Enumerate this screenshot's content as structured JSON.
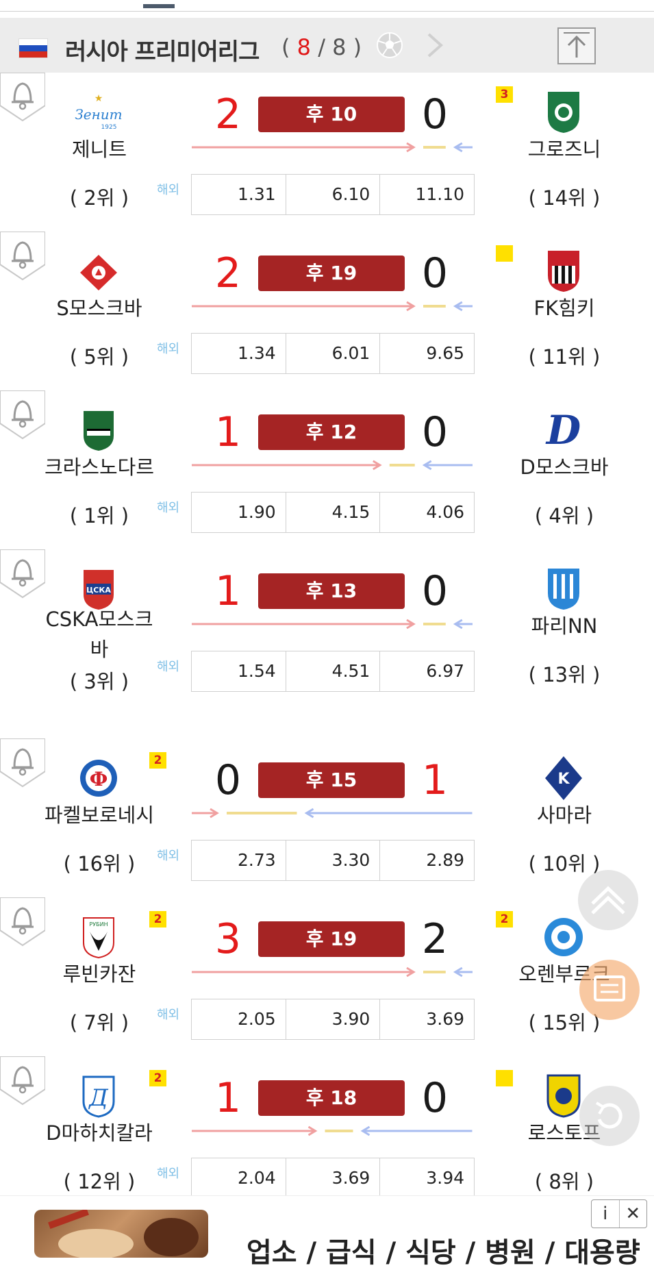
{
  "league": {
    "name": "러시아 프리미어리그",
    "count_open": "( ",
    "count_current": "8",
    "count_sep": " / ",
    "count_total": "8",
    "count_close": " )",
    "flag_colors": [
      "#ffffff",
      "#1f4fbf",
      "#d52b1e"
    ]
  },
  "odds_source_label": "해외",
  "matches": [
    {
      "home": "제니트",
      "home_rank": "( 2위 )",
      "home_score": "2",
      "away_score": "0",
      "status": "후 10",
      "away": "그로즈니",
      "away_rank": "( 14위 )",
      "odds": [
        "1.31",
        "6.10",
        "11.10"
      ],
      "home_card": "",
      "away_card": "3"
    },
    {
      "home": "S모스크바",
      "home_rank": "( 5위 )",
      "home_score": "2",
      "away_score": "0",
      "status": "후 19",
      "away": "FK힘키",
      "away_rank": "( 11위 )",
      "odds": [
        "1.34",
        "6.01",
        "9.65"
      ],
      "home_card": "",
      "away_card": ""
    },
    {
      "home": "크라스노다르",
      "home_rank": "( 1위 )",
      "home_score": "1",
      "away_score": "0",
      "status": "후 12",
      "away": "D모스크바",
      "away_rank": "( 4위 )",
      "odds": [
        "1.90",
        "4.15",
        "4.06"
      ],
      "home_card": "",
      "away_card": ""
    },
    {
      "home": "CSKA모스크바",
      "home_rank": "( 3위 )",
      "home_score": "1",
      "away_score": "0",
      "status": "후 13",
      "away": "파리NN",
      "away_rank": "( 13위 )",
      "odds": [
        "1.54",
        "4.51",
        "6.97"
      ],
      "home_card": "",
      "away_card": ""
    },
    {
      "home": "파켈보로네시",
      "home_rank": "( 16위 )",
      "home_score": "0",
      "away_score": "1",
      "status": "후 15",
      "away": "사마라",
      "away_rank": "( 10위 )",
      "odds": [
        "2.73",
        "3.30",
        "2.89"
      ],
      "home_card": "2",
      "away_card": ""
    },
    {
      "home": "루빈카잔",
      "home_rank": "( 7위 )",
      "home_score": "3",
      "away_score": "2",
      "status": "후 19",
      "away": "오렌부르크",
      "away_rank": "( 15위 )",
      "odds": [
        "2.05",
        "3.90",
        "3.69"
      ],
      "home_card": "2",
      "away_card": "2"
    },
    {
      "home": "D마하치칼라",
      "home_rank": "( 12위 )",
      "home_score": "1",
      "away_score": "0",
      "status": "후 18",
      "away": "로스토프",
      "away_rank": "( 8위 )",
      "odds": [
        "2.04",
        "3.69",
        "3.94"
      ],
      "home_card": "2",
      "away_card": ""
    }
  ],
  "ad": {
    "text": "업소 / 급식 / 식당 / 병원 / 대용량",
    "info_label": "i",
    "close_label": "✕"
  },
  "colors": {
    "score_leading": "#e31b1b",
    "status_badge": "#a52424",
    "home_flow": "#f0a0a0",
    "draw_flow": "#f0dc90",
    "away_flow": "#a8bcf0",
    "yellow_card": "#ffe000"
  }
}
